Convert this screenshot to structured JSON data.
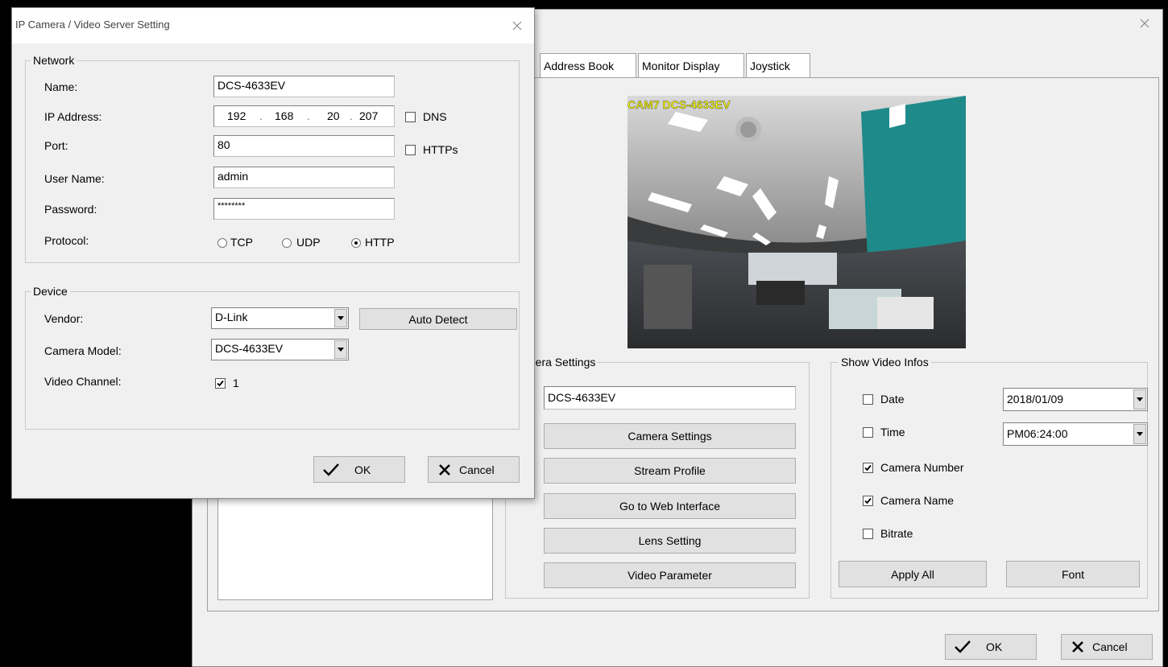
{
  "main_window": {
    "close_icon": "close-icon",
    "tabs": [
      "Address Book",
      "Monitor Display",
      "Joystick"
    ],
    "preview": {
      "overlay_text": "CAM7 DCS-4633EV"
    },
    "camera_settings_group": {
      "label": "mera Settings",
      "name_value": "DCS-4633EV",
      "buttons": [
        "Camera Settings",
        "Stream Profile",
        "Go to Web Interface",
        "Lens Setting",
        "Video Parameter"
      ]
    },
    "show_video_infos": {
      "label": "Show Video Infos",
      "date_label": "Date",
      "date_checked": false,
      "date_value": "2018/01/09",
      "time_label": "Time",
      "time_checked": false,
      "time_value": "PM06:24:00",
      "camera_number_label": "Camera Number",
      "camera_number_checked": true,
      "camera_name_label": "Camera Name",
      "camera_name_checked": true,
      "bitrate_label": "Bitrate",
      "bitrate_checked": false,
      "apply_all_label": "Apply All",
      "font_label": "Font"
    },
    "ok_label": "OK",
    "cancel_label": "Cancel"
  },
  "dialog": {
    "title": "IP Camera / Video Server Setting",
    "network": {
      "label": "Network",
      "name_label": "Name:",
      "name_value": "DCS-4633EV",
      "ip_label": "IP Address:",
      "ip_octets": [
        "192",
        "168",
        "20",
        "207"
      ],
      "dns_label": "DNS",
      "dns_checked": false,
      "port_label": "Port:",
      "port_value": "80",
      "https_label": "HTTPs",
      "https_checked": false,
      "user_label": "User Name:",
      "user_value": "admin",
      "password_label": "Password:",
      "password_value": "********",
      "protocol_label": "Protocol:",
      "protocol_options": [
        "TCP",
        "UDP",
        "HTTP"
      ],
      "protocol_selected": "HTTP"
    },
    "device": {
      "label": "Device",
      "vendor_label": "Vendor:",
      "vendor_value": "D-Link",
      "auto_detect_label": "Auto Detect",
      "model_label": "Camera Model:",
      "model_value": "DCS-4633EV",
      "channel_label": "Video Channel:",
      "channel_value": "1",
      "channel_checked": true
    },
    "ok_label": "OK",
    "cancel_label": "Cancel"
  },
  "colors": {
    "window_bg": "#f0f0f0",
    "desktop_bg": "#000000",
    "button_bg": "#e1e1e1",
    "overlay_text": "#ffff00"
  }
}
